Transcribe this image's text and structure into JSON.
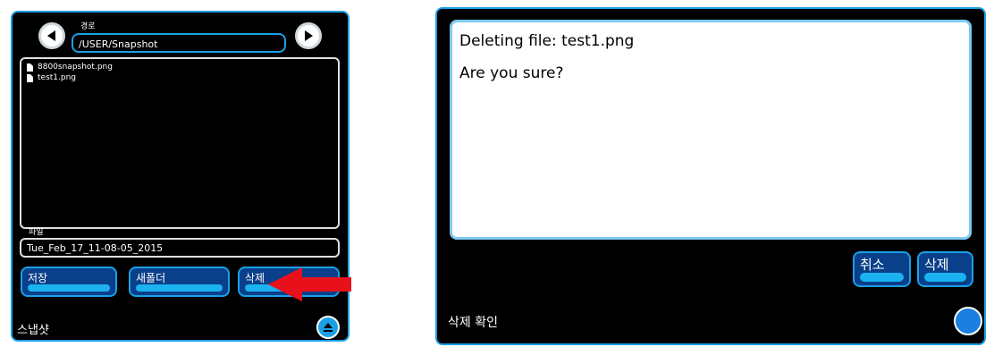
{
  "left_panel": {
    "path_label": "경로",
    "path_value": "/USER/Snapshot",
    "files": [
      {
        "name": "8800snapshot.png",
        "icon": "file-icon"
      },
      {
        "name": "test1.png",
        "icon": "file-icon"
      }
    ],
    "file_label": "파일",
    "file_value": "Tue_Feb_17_11-08-05_2015",
    "buttons": {
      "save": "저장",
      "new_folder": "새폴더",
      "delete": "삭제"
    },
    "title": "스냅샷"
  },
  "right_panel": {
    "message_line1": "Deleting file: test1.png",
    "message_line2": "Are you sure?",
    "buttons": {
      "cancel": "취소",
      "delete": "삭제"
    },
    "title": "삭제 확인"
  },
  "colors": {
    "accent": "#1aa0e6",
    "screen_bg": "#000000",
    "arrow": "#e8111b"
  }
}
